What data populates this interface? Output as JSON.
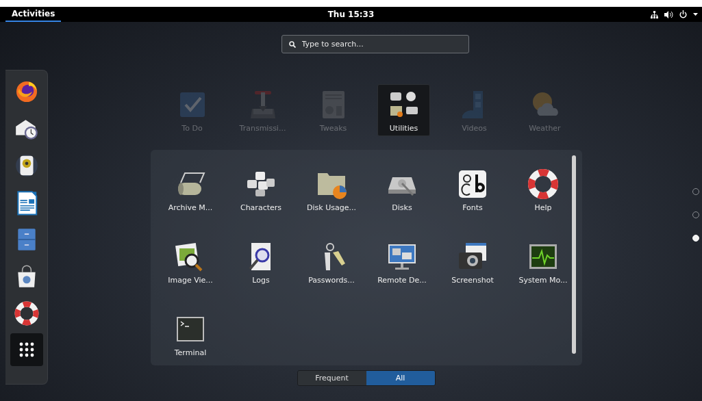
{
  "top_bar": {
    "activities": {
      "label": "Activities",
      "selected": true
    },
    "clock": "Thu 15:33"
  },
  "search": {
    "placeholder": "Type to search..."
  },
  "dock": {
    "show_applications": {
      "selected": true
    }
  },
  "app_row": [
    {
      "label": "To Do",
      "selected": false
    },
    {
      "label": "Transmissi...",
      "selected": false
    },
    {
      "label": "Tweaks",
      "selected": false
    },
    {
      "label": "Utilities",
      "selected": true
    },
    {
      "label": "Videos",
      "selected": false
    },
    {
      "label": "Weather",
      "selected": false
    }
  ],
  "folder": {
    "apps": [
      {
        "label": "Archive M..."
      },
      {
        "label": "Characters"
      },
      {
        "label": "Disk Usage..."
      },
      {
        "label": "Disks"
      },
      {
        "label": "Fonts"
      },
      {
        "label": "Help"
      },
      {
        "label": "Image Vie..."
      },
      {
        "label": "Logs"
      },
      {
        "label": "Passwords..."
      },
      {
        "label": "Remote De..."
      },
      {
        "label": "Screenshot"
      },
      {
        "label": "System Mo..."
      },
      {
        "label": "Terminal"
      }
    ]
  },
  "view_switcher": [
    {
      "label": "Frequent",
      "selected": false
    },
    {
      "label": "All",
      "selected": true
    }
  ],
  "pages": [
    {
      "selected": false
    },
    {
      "selected": false
    },
    {
      "selected": true
    }
  ]
}
